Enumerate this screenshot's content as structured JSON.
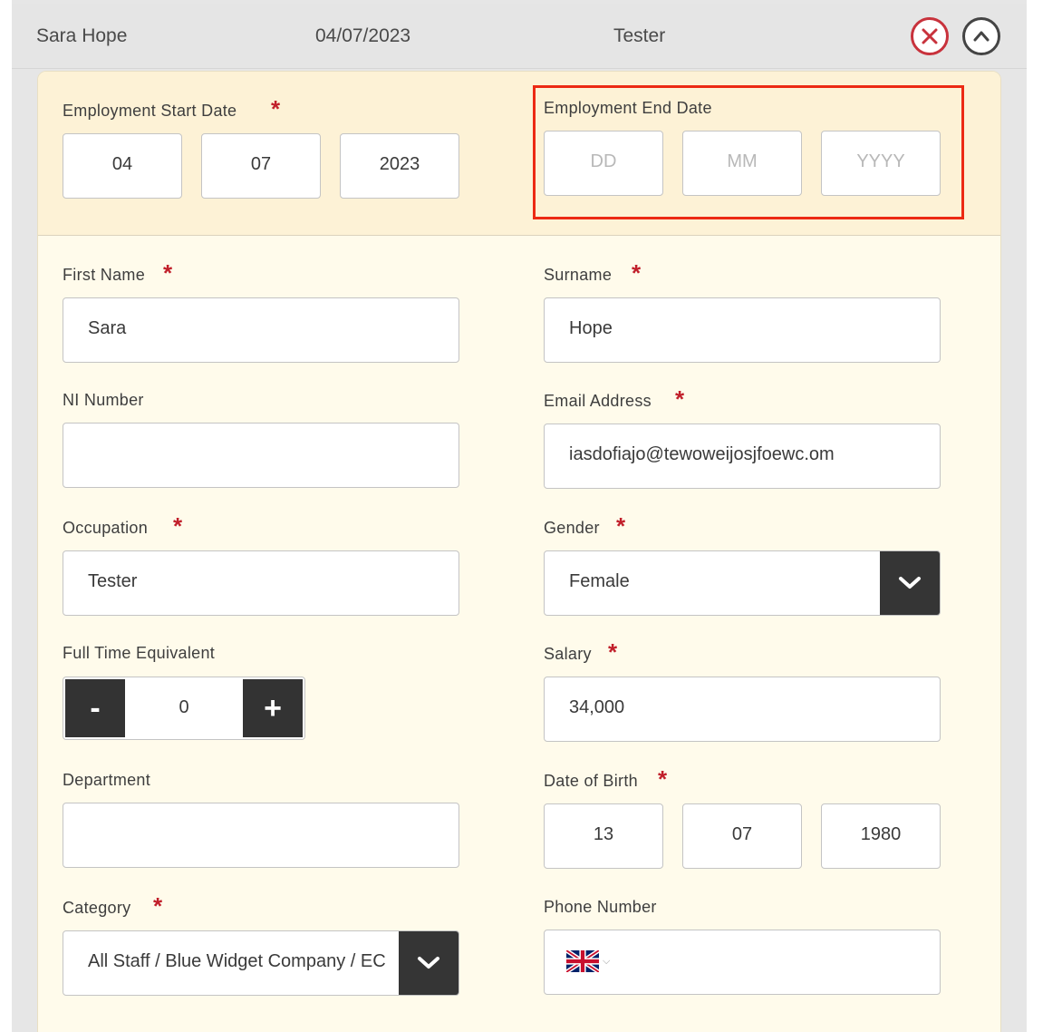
{
  "header": {
    "name": "Sara Hope",
    "date": "04/07/2023",
    "role": "Tester",
    "close_icon": "close-circle-icon",
    "collapse_icon": "chevron-up-circle-icon"
  },
  "form": {
    "start_date": {
      "label": "Employment Start Date",
      "required": "*",
      "dd": "04",
      "mm": "07",
      "yyyy": "2023"
    },
    "end_date": {
      "label": "Employment End Date",
      "dd_placeholder": "DD",
      "mm_placeholder": "MM",
      "yyyy_placeholder": "YYYY"
    },
    "first_name": {
      "label": "First Name",
      "required": "*",
      "value": "Sara"
    },
    "surname": {
      "label": "Surname",
      "required": "*",
      "value": "Hope"
    },
    "ni_number": {
      "label": "NI Number",
      "value": ""
    },
    "email": {
      "label": "Email Address",
      "required": "*",
      "value": "iasdofiajo@tewoweijosjfoewc.om"
    },
    "occupation": {
      "label": "Occupation",
      "required": "*",
      "value": "Tester"
    },
    "gender": {
      "label": "Gender",
      "required": "*",
      "value": "Female"
    },
    "fte": {
      "label": "Full Time Equivalent",
      "minus": "-",
      "plus": "+",
      "value": "0"
    },
    "salary": {
      "label": "Salary",
      "required": "*",
      "value": "34,000"
    },
    "department": {
      "label": "Department",
      "value": ""
    },
    "dob": {
      "label": "Date of Birth",
      "required": "*",
      "dd": "13",
      "mm": "07",
      "yyyy": "1980"
    },
    "category": {
      "label": "Category",
      "required": "*",
      "value": "All Staff / Blue Widget Company / EC"
    },
    "phone": {
      "label": "Phone Number",
      "value": "",
      "flag_icon": "uk-flag-icon"
    }
  },
  "colors": {
    "required": "#c11f2a",
    "highlight": "#ec2a14",
    "panel_bg": "#fffbeb",
    "panel_top_bg": "#fdf2d6",
    "dark_button": "#333333"
  }
}
